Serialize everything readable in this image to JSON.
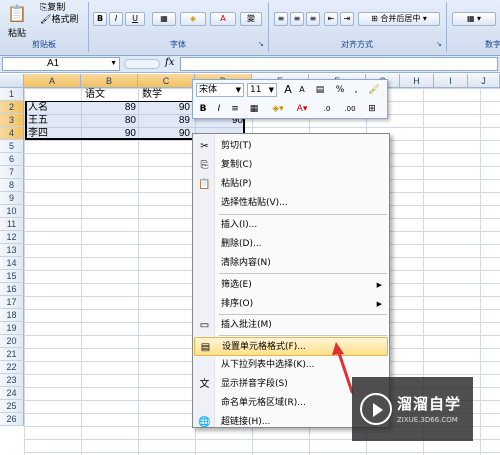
{
  "ribbon": {
    "paste_label": "粘贴",
    "copy_label": "复制",
    "format_painter_label": "格式刷",
    "clipboard_group": "剪贴板",
    "font_group": "字体",
    "alignment_group": "对齐方式",
    "number_group": "数字",
    "merge_center_label": "合并后居中",
    "bold_label": "B",
    "italic_label": "I",
    "underline_label": "U",
    "phonetic_label": "變"
  },
  "formula_bar": {
    "name_box": "A1",
    "fx_label": "fx",
    "formula": ""
  },
  "grid": {
    "columns": [
      "A",
      "B",
      "C",
      "D",
      "E",
      "F",
      "G",
      "H",
      "I",
      "J"
    ],
    "rows": [
      "1",
      "2",
      "3",
      "4",
      "5",
      "6",
      "7",
      "8",
      "9",
      "10",
      "11",
      "12",
      "13",
      "14",
      "15",
      "16",
      "17",
      "18",
      "19",
      "20",
      "21",
      "22",
      "23",
      "24",
      "25",
      "26"
    ],
    "header_row": {
      "b": "语文",
      "c": "数学"
    },
    "data": [
      {
        "name": "人名",
        "b": "89",
        "c": "90"
      },
      {
        "name": "王五",
        "b": "80",
        "c": "89"
      },
      {
        "name": "李四",
        "b": "90",
        "c": "90"
      }
    ],
    "d4": "90"
  },
  "mini_toolbar": {
    "font_name": "宋体",
    "font_size": "11",
    "grow_font": "A",
    "shrink_font": "A",
    "percent": "%",
    "comma": ",",
    "bold": "B",
    "italic": "I",
    "font_color": "A",
    "inc_decimal": ".0",
    "dec_decimal": ".00"
  },
  "context_menu": {
    "items": [
      {
        "label": "剪切(T)",
        "icon": "scissors-icon",
        "glyph": "✂"
      },
      {
        "label": "复制(C)",
        "icon": "copy-icon",
        "glyph": "⎘"
      },
      {
        "label": "粘贴(P)",
        "icon": "paste-icon",
        "glyph": "📋"
      },
      {
        "label": "选择性粘贴(V)...",
        "icon": "",
        "glyph": ""
      },
      {
        "label": "插入(I)...",
        "icon": "",
        "glyph": ""
      },
      {
        "label": "删除(D)...",
        "icon": "",
        "glyph": ""
      },
      {
        "label": "清除内容(N)",
        "icon": "",
        "glyph": ""
      },
      {
        "label": "筛选(E)",
        "icon": "",
        "glyph": "",
        "submenu": true
      },
      {
        "label": "排序(O)",
        "icon": "",
        "glyph": "",
        "submenu": true
      },
      {
        "label": "插入批注(M)",
        "icon": "comment-icon",
        "glyph": "▭"
      },
      {
        "label": "设置单元格格式(F)...",
        "icon": "format-cells-icon",
        "glyph": "▤",
        "highlighted": true
      },
      {
        "label": "从下拉列表中选择(K)...",
        "icon": "",
        "glyph": ""
      },
      {
        "label": "显示拼音字段(S)",
        "icon": "phonetic-icon",
        "glyph": "文"
      },
      {
        "label": "命名单元格区域(R)...",
        "icon": "",
        "glyph": ""
      },
      {
        "label": "超链接(H)...",
        "icon": "hyperlink-icon",
        "glyph": "🌐"
      }
    ]
  },
  "watermark": {
    "title": "溜溜自学",
    "url": "ZIXUE.3D66.COM"
  },
  "colors": {
    "ribbon_text": "#15428b",
    "highlight": "#ffe08a",
    "arrow": "#e03030"
  }
}
